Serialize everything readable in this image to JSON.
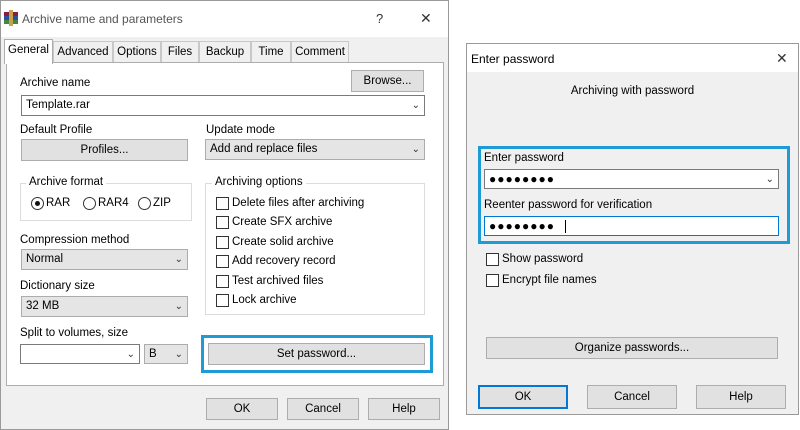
{
  "dialog1": {
    "title": "Archive name and parameters",
    "help_glyph": "?",
    "close_glyph": "✕",
    "tabs": [
      "General",
      "Advanced",
      "Options",
      "Files",
      "Backup",
      "Time",
      "Comment"
    ],
    "archive_name_label": "Archive name",
    "browse_button": "Browse...",
    "archive_name_value": "Template.rar",
    "default_profile_label": "Default Profile",
    "profiles_button": "Profiles...",
    "update_mode_label": "Update mode",
    "update_mode_value": "Add and replace files",
    "archive_format_label": "Archive format",
    "formats": [
      {
        "label": "RAR",
        "selected": true
      },
      {
        "label": "RAR4",
        "selected": false
      },
      {
        "label": "ZIP",
        "selected": false
      }
    ],
    "compression_method_label": "Compression method",
    "compression_method_value": "Normal",
    "dictionary_size_label": "Dictionary size",
    "dictionary_size_value": "32 MB",
    "split_label": "Split to volumes, size",
    "split_value": "",
    "split_unit": "B",
    "archiving_options_label": "Archiving options",
    "options": [
      {
        "label": "Delete files after archiving",
        "checked": false
      },
      {
        "label": "Create SFX archive",
        "checked": false
      },
      {
        "label": "Create solid archive",
        "checked": false
      },
      {
        "label": "Add recovery record",
        "checked": false
      },
      {
        "label": "Test archived files",
        "checked": false
      },
      {
        "label": "Lock archive",
        "checked": false
      }
    ],
    "set_password_button": "Set password...",
    "ok_button": "OK",
    "cancel_button": "Cancel",
    "help_button": "Help"
  },
  "dialog2": {
    "title": "Enter password",
    "close_glyph": "✕",
    "subtitle": "Archiving with password",
    "enter_password_label": "Enter password",
    "enter_password_value": "●●●●●●●●",
    "reenter_label": "Reenter password for verification",
    "reenter_value": "●●●●●●●●",
    "show_password_label": "Show password",
    "show_password_checked": false,
    "encrypt_names_label": "Encrypt file names",
    "encrypt_names_checked": false,
    "organize_button": "Organize passwords...",
    "ok_button": "OK",
    "cancel_button": "Cancel",
    "help_button": "Help"
  },
  "colors": {
    "highlight": "#1e9bd7",
    "dialog_bg": "#f0f0f0",
    "button_bg": "#e1e1e1"
  },
  "icons": {
    "app_icon": "winrar-books-icon",
    "dropdown": "chevron-down-icon"
  }
}
